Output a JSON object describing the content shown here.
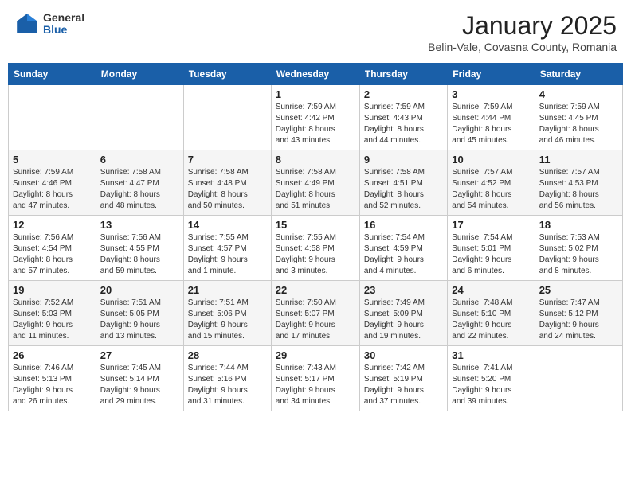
{
  "header": {
    "logo_general": "General",
    "logo_blue": "Blue",
    "month_year": "January 2025",
    "location": "Belin-Vale, Covasna County, Romania"
  },
  "weekdays": [
    "Sunday",
    "Monday",
    "Tuesday",
    "Wednesday",
    "Thursday",
    "Friday",
    "Saturday"
  ],
  "weeks": [
    [
      {
        "day": "",
        "info": ""
      },
      {
        "day": "",
        "info": ""
      },
      {
        "day": "",
        "info": ""
      },
      {
        "day": "1",
        "info": "Sunrise: 7:59 AM\nSunset: 4:42 PM\nDaylight: 8 hours\nand 43 minutes."
      },
      {
        "day": "2",
        "info": "Sunrise: 7:59 AM\nSunset: 4:43 PM\nDaylight: 8 hours\nand 44 minutes."
      },
      {
        "day": "3",
        "info": "Sunrise: 7:59 AM\nSunset: 4:44 PM\nDaylight: 8 hours\nand 45 minutes."
      },
      {
        "day": "4",
        "info": "Sunrise: 7:59 AM\nSunset: 4:45 PM\nDaylight: 8 hours\nand 46 minutes."
      }
    ],
    [
      {
        "day": "5",
        "info": "Sunrise: 7:59 AM\nSunset: 4:46 PM\nDaylight: 8 hours\nand 47 minutes."
      },
      {
        "day": "6",
        "info": "Sunrise: 7:58 AM\nSunset: 4:47 PM\nDaylight: 8 hours\nand 48 minutes."
      },
      {
        "day": "7",
        "info": "Sunrise: 7:58 AM\nSunset: 4:48 PM\nDaylight: 8 hours\nand 50 minutes."
      },
      {
        "day": "8",
        "info": "Sunrise: 7:58 AM\nSunset: 4:49 PM\nDaylight: 8 hours\nand 51 minutes."
      },
      {
        "day": "9",
        "info": "Sunrise: 7:58 AM\nSunset: 4:51 PM\nDaylight: 8 hours\nand 52 minutes."
      },
      {
        "day": "10",
        "info": "Sunrise: 7:57 AM\nSunset: 4:52 PM\nDaylight: 8 hours\nand 54 minutes."
      },
      {
        "day": "11",
        "info": "Sunrise: 7:57 AM\nSunset: 4:53 PM\nDaylight: 8 hours\nand 56 minutes."
      }
    ],
    [
      {
        "day": "12",
        "info": "Sunrise: 7:56 AM\nSunset: 4:54 PM\nDaylight: 8 hours\nand 57 minutes."
      },
      {
        "day": "13",
        "info": "Sunrise: 7:56 AM\nSunset: 4:55 PM\nDaylight: 8 hours\nand 59 minutes."
      },
      {
        "day": "14",
        "info": "Sunrise: 7:55 AM\nSunset: 4:57 PM\nDaylight: 9 hours\nand 1 minute."
      },
      {
        "day": "15",
        "info": "Sunrise: 7:55 AM\nSunset: 4:58 PM\nDaylight: 9 hours\nand 3 minutes."
      },
      {
        "day": "16",
        "info": "Sunrise: 7:54 AM\nSunset: 4:59 PM\nDaylight: 9 hours\nand 4 minutes."
      },
      {
        "day": "17",
        "info": "Sunrise: 7:54 AM\nSunset: 5:01 PM\nDaylight: 9 hours\nand 6 minutes."
      },
      {
        "day": "18",
        "info": "Sunrise: 7:53 AM\nSunset: 5:02 PM\nDaylight: 9 hours\nand 8 minutes."
      }
    ],
    [
      {
        "day": "19",
        "info": "Sunrise: 7:52 AM\nSunset: 5:03 PM\nDaylight: 9 hours\nand 11 minutes."
      },
      {
        "day": "20",
        "info": "Sunrise: 7:51 AM\nSunset: 5:05 PM\nDaylight: 9 hours\nand 13 minutes."
      },
      {
        "day": "21",
        "info": "Sunrise: 7:51 AM\nSunset: 5:06 PM\nDaylight: 9 hours\nand 15 minutes."
      },
      {
        "day": "22",
        "info": "Sunrise: 7:50 AM\nSunset: 5:07 PM\nDaylight: 9 hours\nand 17 minutes."
      },
      {
        "day": "23",
        "info": "Sunrise: 7:49 AM\nSunset: 5:09 PM\nDaylight: 9 hours\nand 19 minutes."
      },
      {
        "day": "24",
        "info": "Sunrise: 7:48 AM\nSunset: 5:10 PM\nDaylight: 9 hours\nand 22 minutes."
      },
      {
        "day": "25",
        "info": "Sunrise: 7:47 AM\nSunset: 5:12 PM\nDaylight: 9 hours\nand 24 minutes."
      }
    ],
    [
      {
        "day": "26",
        "info": "Sunrise: 7:46 AM\nSunset: 5:13 PM\nDaylight: 9 hours\nand 26 minutes."
      },
      {
        "day": "27",
        "info": "Sunrise: 7:45 AM\nSunset: 5:14 PM\nDaylight: 9 hours\nand 29 minutes."
      },
      {
        "day": "28",
        "info": "Sunrise: 7:44 AM\nSunset: 5:16 PM\nDaylight: 9 hours\nand 31 minutes."
      },
      {
        "day": "29",
        "info": "Sunrise: 7:43 AM\nSunset: 5:17 PM\nDaylight: 9 hours\nand 34 minutes."
      },
      {
        "day": "30",
        "info": "Sunrise: 7:42 AM\nSunset: 5:19 PM\nDaylight: 9 hours\nand 37 minutes."
      },
      {
        "day": "31",
        "info": "Sunrise: 7:41 AM\nSunset: 5:20 PM\nDaylight: 9 hours\nand 39 minutes."
      },
      {
        "day": "",
        "info": ""
      }
    ]
  ]
}
